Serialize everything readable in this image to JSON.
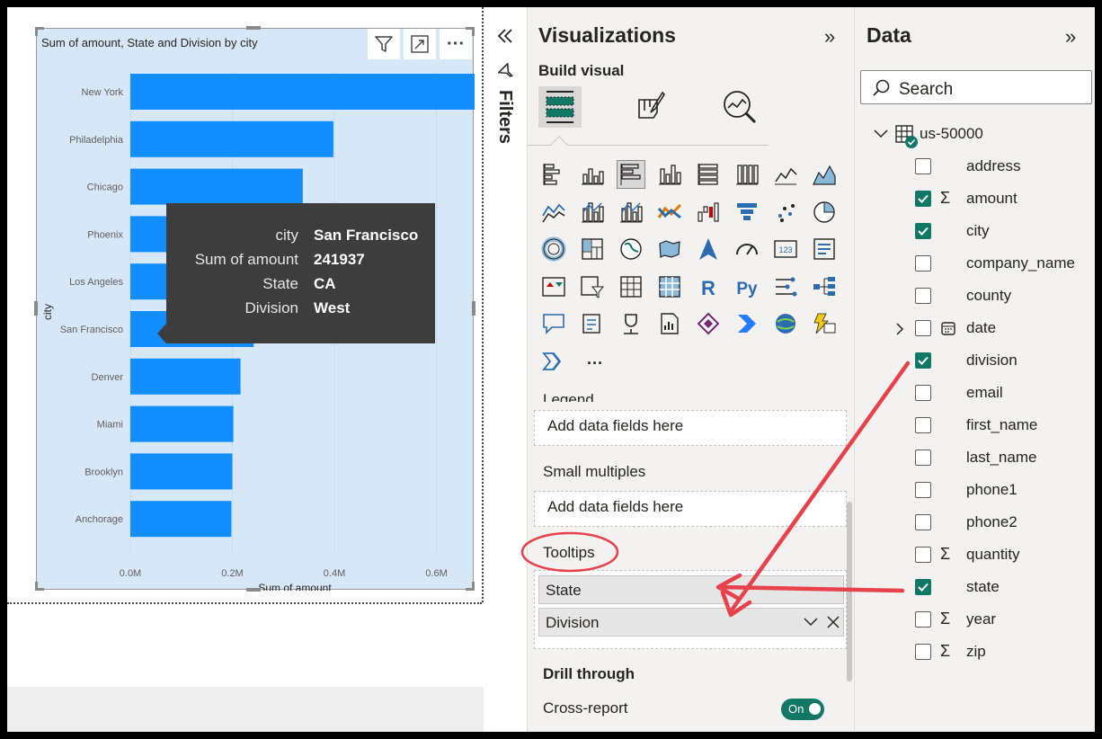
{
  "chart": {
    "title": "Sum of amount, State and Division by city",
    "more_label": "···",
    "tooltip": [
      {
        "key": "city",
        "value": "San Francisco"
      },
      {
        "key": "Sum of amount",
        "value": "241937"
      },
      {
        "key": "State",
        "value": "CA"
      },
      {
        "key": "Division",
        "value": "West"
      }
    ]
  },
  "chart_data": {
    "type": "bar",
    "orientation": "horizontal",
    "title": "Sum of amount, State and Division by city",
    "xlabel": "Sum of amount",
    "ylabel": "city",
    "categories": [
      "New York",
      "Philadelphia",
      "Chicago",
      "Phoenix",
      "Los Angeles",
      "San Francisco",
      "Denver",
      "Miami",
      "Brooklyn",
      "Anchorage"
    ],
    "values": [
      678000,
      398000,
      338000,
      290000,
      258000,
      241937,
      216000,
      202000,
      200000,
      198000
    ],
    "xticks": [
      "0.0M",
      "0.2M",
      "0.4M",
      "0.6M"
    ],
    "xlim": [
      0,
      740000
    ],
    "grid": true,
    "bar_color": "#118DFF"
  },
  "filters": {
    "label": "Filters"
  },
  "visualizations": {
    "title": "Visualizations",
    "collapse": "»",
    "build_label": "Build visual",
    "legend_label": "Legend",
    "legend_placeholder": "Add data fields here",
    "small_multiples_label": "Small multiples",
    "small_multiples_placeholder": "Add data fields here",
    "tooltips_label": "Tooltips",
    "tooltip_fields": [
      "State",
      "Division"
    ],
    "drill_through_label": "Drill through",
    "cross_report_label": "Cross-report",
    "toggle_label": "On",
    "more_visuals": "···"
  },
  "data": {
    "title": "Data",
    "collapse": "»",
    "search_placeholder": "Search",
    "table_name": "us-50000",
    "fields": [
      {
        "name": "address",
        "checked": false,
        "sigma": false
      },
      {
        "name": "amount",
        "checked": true,
        "sigma": true
      },
      {
        "name": "city",
        "checked": true,
        "sigma": false
      },
      {
        "name": "company_name",
        "checked": false,
        "sigma": false
      },
      {
        "name": "county",
        "checked": false,
        "sigma": false
      },
      {
        "name": "date",
        "checked": false,
        "sigma": false,
        "expandable": true
      },
      {
        "name": "division",
        "checked": true,
        "sigma": false
      },
      {
        "name": "email",
        "checked": false,
        "sigma": false
      },
      {
        "name": "first_name",
        "checked": false,
        "sigma": false
      },
      {
        "name": "last_name",
        "checked": false,
        "sigma": false
      },
      {
        "name": "phone1",
        "checked": false,
        "sigma": false
      },
      {
        "name": "phone2",
        "checked": false,
        "sigma": false
      },
      {
        "name": "quantity",
        "checked": false,
        "sigma": true
      },
      {
        "name": "state",
        "checked": true,
        "sigma": false
      },
      {
        "name": "year",
        "checked": false,
        "sigma": true
      },
      {
        "name": "zip",
        "checked": false,
        "sigma": true
      }
    ]
  },
  "colors": {
    "accent": "#117865",
    "bar": "#118DFF",
    "annotation": "#E8414B"
  }
}
